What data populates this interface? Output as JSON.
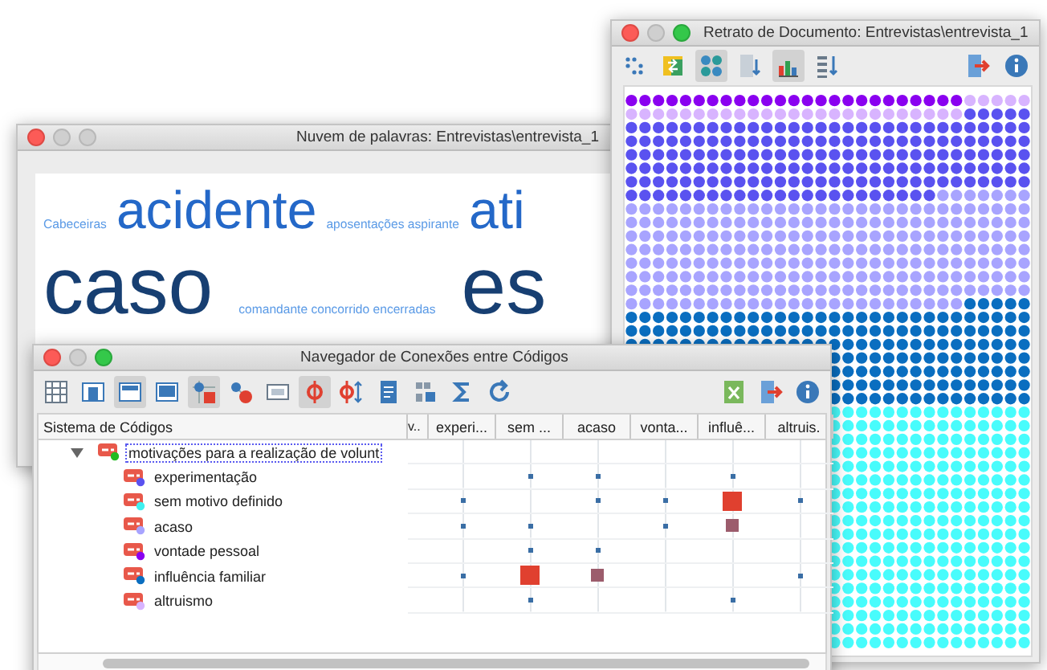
{
  "word_cloud_window": {
    "title": "Nuvem de palavras: Entrevistas\\entrevista_1",
    "zoom_button_enabled": false,
    "words": [
      {
        "text": "Cabeceiras",
        "kind": "small"
      },
      {
        "text": "acidente",
        "kind": "large"
      },
      {
        "text": "aposentações aspirante",
        "kind": "small"
      },
      {
        "text": "ati",
        "kind": "large"
      },
      {
        "text": "caso",
        "kind": "huge"
      },
      {
        "text": "comandante concorrido encerradas",
        "kind": "small"
      },
      {
        "text": "es",
        "kind": "huge"
      }
    ]
  },
  "portrait_window": {
    "title": "Retrato de Documento: Entrevistas\\entrevista_1",
    "zoom_button_enabled": true,
    "toolbar_left": [
      {
        "kind": "dot-grid",
        "pressed": false
      },
      {
        "kind": "swap-square",
        "pressed": false
      },
      {
        "kind": "four-dots",
        "pressed": true
      },
      {
        "kind": "page-arrow",
        "pressed": false
      },
      {
        "kind": "bar-chart",
        "pressed": true
      },
      {
        "kind": "list-sort",
        "pressed": false
      }
    ],
    "toolbar_right": [
      {
        "kind": "exit",
        "pressed": false
      },
      {
        "kind": "info",
        "pressed": false
      }
    ]
  },
  "browser_window": {
    "title": "Navegador de Conexões entre Códigos",
    "zoom_button_enabled": true,
    "toolbar_left": [
      {
        "kind": "table",
        "pressed": false
      },
      {
        "kind": "column-left",
        "pressed": false
      },
      {
        "kind": "column-center",
        "pressed": true
      },
      {
        "kind": "column-wide",
        "pressed": false
      },
      {
        "kind": "node-square",
        "pressed": true
      },
      {
        "kind": "node-circle",
        "pressed": false
      },
      {
        "kind": "number-field",
        "pressed": false
      },
      {
        "kind": "split-node",
        "pressed": true
      },
      {
        "kind": "split-sort",
        "pressed": false
      },
      {
        "kind": "document",
        "pressed": false
      },
      {
        "kind": "matrix",
        "pressed": false
      },
      {
        "kind": "sigma",
        "pressed": false
      },
      {
        "kind": "refresh",
        "pressed": false
      }
    ],
    "toolbar_right": [
      {
        "kind": "spreadsheet",
        "pressed": false
      },
      {
        "kind": "exit",
        "pressed": false
      },
      {
        "kind": "info",
        "pressed": false
      }
    ],
    "code_system_header": "Sistema de Códigos",
    "columns": [
      "v..",
      "experi...",
      "sem ...",
      "acaso",
      "vonta...",
      "influê...",
      "altruis."
    ],
    "root": {
      "label": "motivações para a realização de volunt",
      "color": "#22bb22",
      "expanded": true,
      "selected": true,
      "children": [
        {
          "label": "experimentação",
          "color": "#5a52f0",
          "selected": false,
          "cells": [
            {
              "kind": "empty"
            },
            {
              "kind": "empty"
            },
            {
              "kind": "dot"
            },
            {
              "kind": "dot"
            },
            {
              "kind": "empty"
            },
            {
              "kind": "dot"
            },
            {
              "kind": "empty"
            }
          ]
        },
        {
          "label": "sem motivo definido",
          "color": "#40f0f0",
          "selected": false,
          "cells": [
            {
              "kind": "empty"
            },
            {
              "kind": "dot"
            },
            {
              "kind": "empty"
            },
            {
              "kind": "dot"
            },
            {
              "kind": "dot"
            },
            {
              "kind": "large"
            },
            {
              "kind": "dot"
            }
          ]
        },
        {
          "label": "acaso",
          "color": "#a8a4ff",
          "selected": false,
          "cells": [
            {
              "kind": "empty"
            },
            {
              "kind": "dot"
            },
            {
              "kind": "dot"
            },
            {
              "kind": "empty"
            },
            {
              "kind": "dot"
            },
            {
              "kind": "medium"
            },
            {
              "kind": "empty"
            }
          ]
        },
        {
          "label": "vontade pessoal",
          "color": "#8a00f0",
          "selected": false,
          "cells": [
            {
              "kind": "empty"
            },
            {
              "kind": "empty"
            },
            {
              "kind": "dot"
            },
            {
              "kind": "dot"
            },
            {
              "kind": "empty"
            },
            {
              "kind": "empty"
            },
            {
              "kind": "empty"
            }
          ]
        },
        {
          "label": "influência familiar",
          "color": "#0a6ec0",
          "selected": false,
          "cells": [
            {
              "kind": "empty"
            },
            {
              "kind": "dot"
            },
            {
              "kind": "large"
            },
            {
              "kind": "medium"
            },
            {
              "kind": "empty"
            },
            {
              "kind": "empty"
            },
            {
              "kind": "dot"
            }
          ]
        },
        {
          "label": "altruismo",
          "color": "#d8b4ff",
          "selected": false,
          "cells": [
            {
              "kind": "empty"
            },
            {
              "kind": "empty"
            },
            {
              "kind": "dot"
            },
            {
              "kind": "empty"
            },
            {
              "kind": "empty"
            },
            {
              "kind": "dot"
            },
            {
              "kind": "empty"
            }
          ]
        }
      ]
    }
  }
}
